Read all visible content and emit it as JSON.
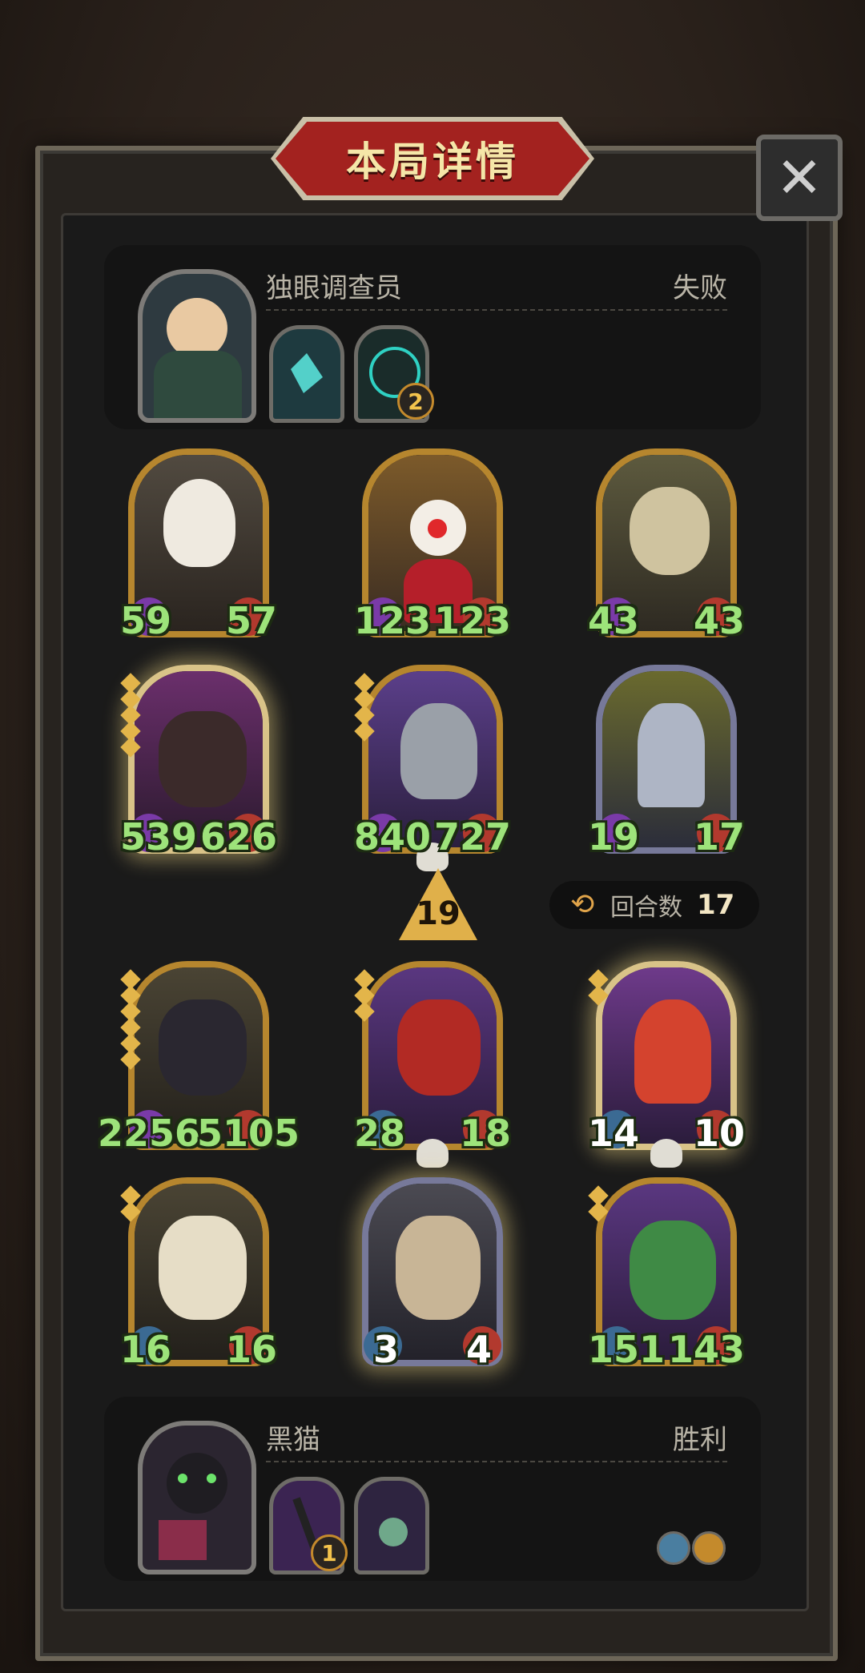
{
  "title": "本局详情",
  "close_glyph": "✕",
  "top_player": {
    "name": "独眼调查员",
    "result": "失败",
    "items": [
      {
        "name": "shard-item",
        "badge": ""
      },
      {
        "name": "spirit-item",
        "badge": "2"
      }
    ]
  },
  "bottom_player": {
    "name": "黑猫",
    "result": "胜利",
    "items": [
      {
        "name": "dagger-item",
        "badge": "1"
      },
      {
        "name": "potion-item",
        "badge": ""
      }
    ]
  },
  "top_board": [
    {
      "name": "bull-terrier-card",
      "attack": "59",
      "health": "57"
    },
    {
      "name": "clown-card",
      "attack": "123",
      "health": "123"
    },
    {
      "name": "tiger-card",
      "attack": "43",
      "health": "43"
    },
    {
      "name": "dark-dragon-card",
      "attack": "539",
      "health": "626"
    },
    {
      "name": "rhino-card",
      "attack": "840",
      "health": "727"
    },
    {
      "name": "knight-card",
      "attack": "19",
      "health": "17"
    }
  ],
  "tier": "19",
  "rounds": {
    "label": "回合数",
    "value": "17"
  },
  "bottom_board": [
    {
      "name": "shadow-dragon-card",
      "attack": "2256",
      "health": "5105"
    },
    {
      "name": "demon-card",
      "attack": "28",
      "health": "18"
    },
    {
      "name": "elf-girl-card",
      "attack": "14",
      "health": "10"
    },
    {
      "name": "jade-dragon-card",
      "attack": "16",
      "health": "16"
    },
    {
      "name": "lion-beast-card",
      "attack": "3",
      "health": "4"
    },
    {
      "name": "croc-card",
      "attack": "151",
      "health": "143"
    }
  ],
  "colors": {
    "gold": "#b6862e",
    "stat_green": "#9de37a",
    "title_red": "#a3221f"
  }
}
